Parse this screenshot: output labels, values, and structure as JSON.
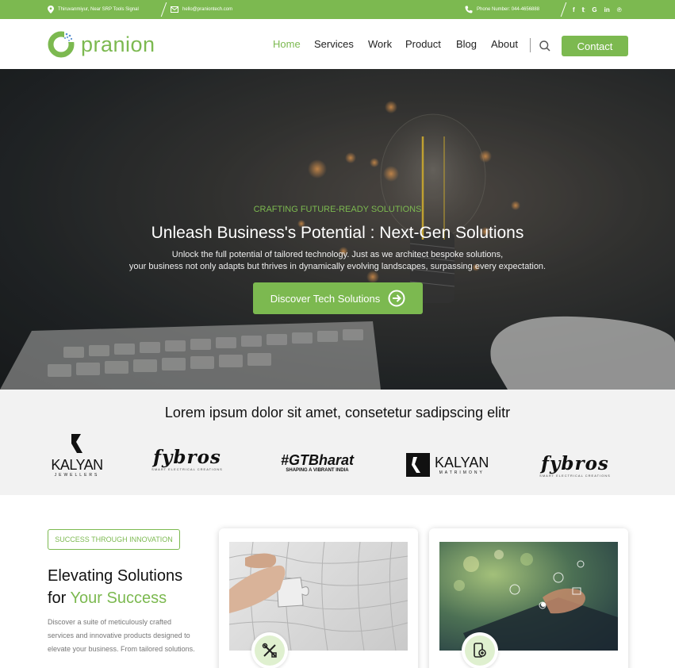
{
  "topbar": {
    "address": "Thiruvanmiyur, Near SRP Tools Signal",
    "email": "hello@praniontech.com",
    "phone": "Phone Number: 044-4656888",
    "social": [
      "f",
      "𝕥",
      "G",
      "in",
      "℗"
    ]
  },
  "header": {
    "logo_text": "pranion",
    "nav": [
      "Home",
      "Services",
      "Work",
      "Product",
      "Blog",
      "About"
    ],
    "contact_label": "Contact"
  },
  "hero": {
    "subtitle": "CRAFTING FUTURE-READY SOLUTIONS",
    "title": "Unleash Business's Potential : Next-Gen Solutions",
    "desc_line1": "Unlock the full potential of tailored technology. Just as we architect bespoke solutions,",
    "desc_line2": "your business not only adapts but thrives in dynamically evolving landscapes, surpassing every expectation.",
    "cta_label": "Discover Tech Solutions"
  },
  "clients": {
    "title": "Lorem ipsum dolor sit amet, consetetur sadipscing elitr",
    "brands": [
      {
        "name": "KALYAN",
        "tagline": "JEWELLERS"
      },
      {
        "name": "fybros",
        "tagline": "SMART ELECTRICAL CREATIONS"
      },
      {
        "name": "#GTBharat",
        "tagline": "SHAPING A VIBRANT INDIA"
      },
      {
        "name": "KALYAN",
        "tagline": "MATRIMONY"
      },
      {
        "name": "fybros",
        "tagline": "SMART ELECTRICAL CREATIONS"
      }
    ]
  },
  "section": {
    "pill": "SUCCESS THROUGH INNOVATION",
    "title_line1": "Elevating Solutions",
    "title_line2_prefix": "for ",
    "title_line2_highlight": "Your Success",
    "desc": "Discover a suite of meticulously crafted services and innovative products designed to elevate your business. From tailored solutions."
  },
  "colors": {
    "accent": "#7cb950",
    "topbar": "#7cb950",
    "text": "#222222"
  }
}
